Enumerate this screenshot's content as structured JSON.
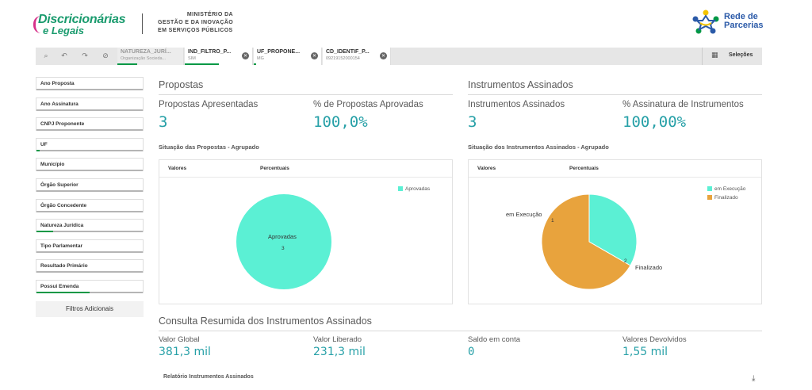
{
  "header": {
    "logo_line1": "Discricionárias",
    "logo_line2": "e Legais",
    "ministry_line1": "MINISTÉRIO DA",
    "ministry_line2": "GESTÃO E DA INOVAÇÃO",
    "ministry_line3": "EM SERVIÇOS PÚBLICOS",
    "partner_line1": "Rede de",
    "partner_line2": "Parcerias"
  },
  "toolbar": {
    "chips": [
      {
        "title": "NATUREZA_JURÍ...",
        "value": "Organização Socieda..."
      },
      {
        "title": "IND_FILTRO_P...",
        "value": "SIM"
      },
      {
        "title": "UF_PROPONE...",
        "value": "MG"
      },
      {
        "title": "CD_IDENTIF_P...",
        "value": "09219152000154"
      }
    ],
    "selections_label": "Seleções"
  },
  "filters": {
    "items": [
      {
        "label": "Ano Proposta",
        "fill": 0
      },
      {
        "label": "Ano Assinatura",
        "fill": 0
      },
      {
        "label": "CNPJ Proponente",
        "fill": 0
      },
      {
        "label": "UF",
        "fill": 0.03
      },
      {
        "label": "Município",
        "fill": 0
      },
      {
        "label": "Órgão Superior",
        "fill": 0
      },
      {
        "label": "Órgão Concedente",
        "fill": 0
      },
      {
        "label": "Natureza Jurídica",
        "fill": 0.16
      },
      {
        "label": "Tipo Parlamentar",
        "fill": 0
      },
      {
        "label": "Resultado Primário",
        "fill": 0
      },
      {
        "label": "Possui Emenda",
        "fill": 0.5
      }
    ],
    "more_label": "Filtros Adicionais"
  },
  "propostas": {
    "title": "Propostas",
    "kpi1_label": "Propostas Apresentadas",
    "kpi1_value": "3",
    "kpi2_label": "% de Propostas Aprovadas",
    "kpi2_value": "100,0%",
    "chart_title": "Situação das Propostas - Agrupado",
    "tab1": "Valores",
    "tab2": "Percentuais"
  },
  "instrumentos": {
    "title": "Instrumentos Assinados",
    "kpi1_label": "Instrumentos Assinados",
    "kpi1_value": "3",
    "kpi2_label": "% Assinatura de Instrumentos",
    "kpi2_value": "100,00%",
    "chart_title": "Situação dos Instrumentos Assinados - Agrupado",
    "tab1": "Valores",
    "tab2": "Percentuais"
  },
  "consulta": {
    "title": "Consulta Resumida dos Instrumentos Assinados",
    "items": [
      {
        "label": "Valor Global",
        "value": "381,3 mil"
      },
      {
        "label": "Valor Liberado",
        "value": "231,3 mil"
      },
      {
        "label": "Saldo em conta",
        "value": "0"
      },
      {
        "label": "Valores Devolvidos",
        "value": "1,55 mil"
      }
    ],
    "report_label": "Relatório Instrumentos Assinados"
  },
  "chart_data": [
    {
      "type": "pie",
      "title": "Situação das Propostas - Agrupado",
      "categories": [
        "Aprovadas"
      ],
      "values": [
        3
      ],
      "colors": [
        "#5bf0d4"
      ],
      "legend": "top-right"
    },
    {
      "type": "pie",
      "title": "Situação dos Instrumentos Assinados - Agrupado",
      "categories": [
        "em Execução",
        "Finalizado"
      ],
      "values": [
        1,
        2
      ],
      "colors": [
        "#5bf0d4",
        "#e8a33d"
      ],
      "legend": "top-right"
    }
  ]
}
